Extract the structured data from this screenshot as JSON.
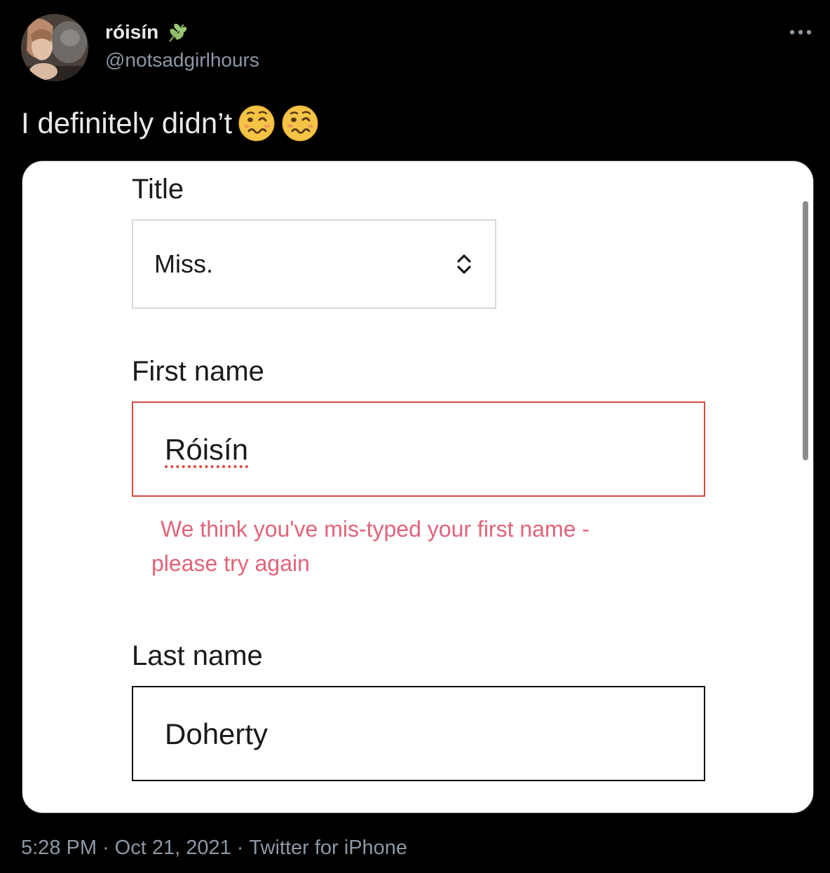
{
  "tweet": {
    "display_name": "róisín",
    "name_icon": "sprig-icon",
    "handle": "@notsadgirlhours",
    "text": "I definitely didn’t",
    "emojis": [
      "woozy-face-icon",
      "woozy-face-icon"
    ],
    "more_icon": "more-dots-icon",
    "time": "5:28 PM",
    "separator": "·",
    "date": "Oct 21, 2021",
    "source": "Twitter for iPhone"
  },
  "form": {
    "title_label": "Title",
    "title_value": "Miss.",
    "title_icon": "select-arrows-icon",
    "first_name_label": "First name",
    "first_name_value": "Róisín",
    "first_name_error_line1": "We think you've mis-typed your first name -",
    "first_name_error_line2": "please try again",
    "last_name_label": "Last name",
    "last_name_value": "Doherty"
  },
  "colors": {
    "background": "#000000",
    "card": "#ffffff",
    "error": "#d9483f",
    "error_text": "#e0647a",
    "muted_text": "#8b98a5",
    "primary_text": "#e7e9ea"
  }
}
